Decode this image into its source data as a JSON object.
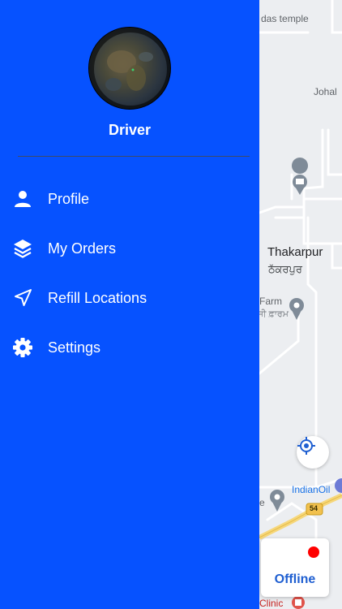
{
  "map": {
    "labels": {
      "temple": "das temple",
      "johal": "Johal",
      "town_en": "Thakarpur",
      "town_pa": "ਠੱਕਰਪੁਰ",
      "farm_en": "Farm",
      "farm_pa": "ਜੀ ਫ਼ਾਰਮ",
      "indianoil": "IndianOil",
      "route": "54",
      "edge_e": "e",
      "clinic": "Clinic"
    },
    "locate_icon": "crosshair-icon"
  },
  "status_card": {
    "label": "Offline",
    "dot_color": "#ff0000"
  },
  "drawer": {
    "background": "#0652ff",
    "user_name": "Driver",
    "menu": [
      {
        "label": "Profile",
        "icon": "person-icon"
      },
      {
        "label": "My Orders",
        "icon": "layers-icon"
      },
      {
        "label": "Refill Locations",
        "icon": "navigation-arrow-icon"
      },
      {
        "label": "Settings",
        "icon": "gear-icon"
      }
    ]
  }
}
